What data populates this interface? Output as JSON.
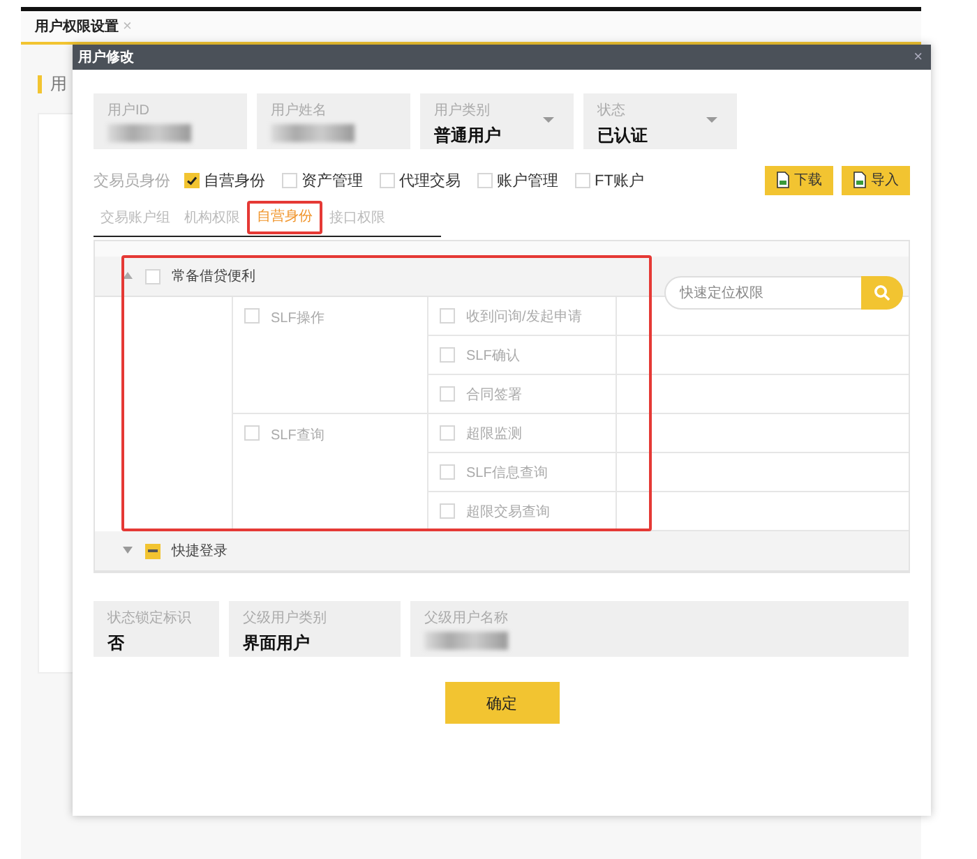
{
  "page_tab": {
    "label": "用户权限设置",
    "close": "×"
  },
  "background_label": "用",
  "dialog": {
    "title": "用户修改",
    "close": "×"
  },
  "fields": [
    {
      "label": "用户ID",
      "kind": "redacted"
    },
    {
      "label": "用户姓名",
      "kind": "redacted"
    },
    {
      "label": "用户类别",
      "value": "普通用户",
      "kind": "select"
    },
    {
      "label": "状态",
      "value": "已认证",
      "kind": "select"
    }
  ],
  "identity": {
    "label": "交易员身份",
    "options": [
      {
        "label": "自营身份",
        "checked": true
      },
      {
        "label": "资产管理",
        "checked": false
      },
      {
        "label": "代理交易",
        "checked": false
      },
      {
        "label": "账户管理",
        "checked": false
      },
      {
        "label": "FT账户",
        "checked": false
      }
    ]
  },
  "buttons": [
    {
      "label": "下载"
    },
    {
      "label": "导入"
    }
  ],
  "tabs": [
    {
      "label": "交易账户组",
      "selected": false,
      "highlighted": false
    },
    {
      "label": "机构权限",
      "selected": false,
      "highlighted": false
    },
    {
      "label": "自营身份",
      "selected": true,
      "highlighted": true
    },
    {
      "label": "接口权限",
      "selected": false,
      "highlighted": false
    }
  ],
  "search": {
    "placeholder": "快速定位权限"
  },
  "groups": [
    {
      "label": "常备借贷便利",
      "expanded": true,
      "checked": false,
      "indeterminate": false,
      "highlighted": true,
      "children": [
        {
          "label": "SLF操作",
          "checked": false,
          "children": [
            {
              "label": "收到问询/发起申请",
              "checked": false
            },
            {
              "label": "SLF确认",
              "checked": false
            },
            {
              "label": "合同签署",
              "checked": false
            }
          ]
        },
        {
          "label": "SLF查询",
          "checked": false,
          "children": [
            {
              "label": "超限监测",
              "checked": false
            },
            {
              "label": "SLF信息查询",
              "checked": false
            },
            {
              "label": "超限交易查询",
              "checked": false
            }
          ]
        }
      ]
    },
    {
      "label": "快捷登录",
      "expanded": false,
      "indeterminate": true,
      "highlighted": false
    }
  ],
  "bottom_fields": [
    {
      "label": "状态锁定标识",
      "value": "否",
      "kind": "text"
    },
    {
      "label": "父级用户类别",
      "value": "界面用户",
      "kind": "text"
    },
    {
      "label": "父级用户名称",
      "kind": "redacted"
    }
  ],
  "confirm": {
    "label": "确定"
  }
}
